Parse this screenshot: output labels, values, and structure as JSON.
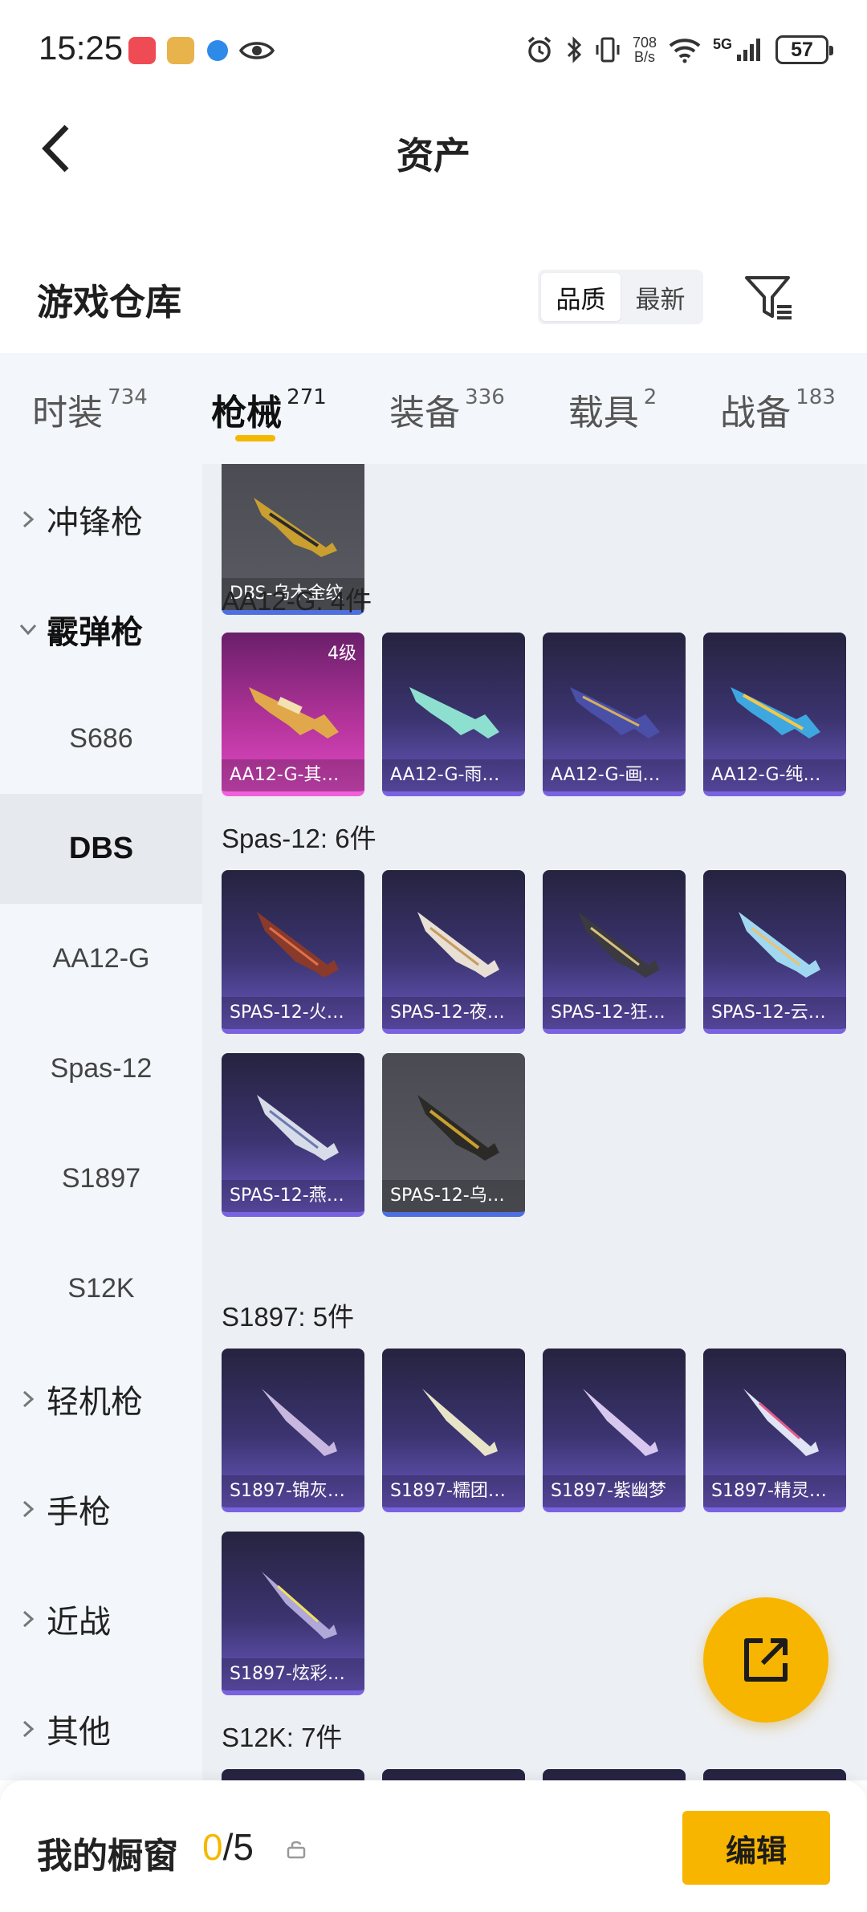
{
  "status_bar": {
    "time": "15:25",
    "net_speed_value": "708",
    "net_speed_unit": "B/s",
    "network": "5G",
    "battery": "57"
  },
  "header": {
    "title": "资产"
  },
  "warehouse": {
    "title": "游戏仓库",
    "sort_options": [
      "品质",
      "最新"
    ],
    "active_sort": "品质"
  },
  "tabs": [
    {
      "label": "时装",
      "count": "734"
    },
    {
      "label": "枪械",
      "count": "271"
    },
    {
      "label": "装备",
      "count": "336"
    },
    {
      "label": "载具",
      "count": "2"
    },
    {
      "label": "战备",
      "count": "183"
    }
  ],
  "sidebar": {
    "items": [
      {
        "label": "冲锋枪"
      },
      {
        "label": "霰弹枪"
      },
      {
        "label": "S686"
      },
      {
        "label": "DBS"
      },
      {
        "label": "AA12-G"
      },
      {
        "label": "Spas-12"
      },
      {
        "label": "S1897"
      },
      {
        "label": "S12K"
      },
      {
        "label": "轻机枪"
      },
      {
        "label": "手枪"
      },
      {
        "label": "近战"
      },
      {
        "label": "其他"
      }
    ]
  },
  "groups": {
    "dbs": {
      "items": [
        {
          "name": "DBS-乌木金纹"
        }
      ]
    },
    "aa12": {
      "title": "AA12-G: 4件",
      "items": [
        {
          "name": "AA12-G-其…",
          "badge": "4级"
        },
        {
          "name": "AA12-G-雨…"
        },
        {
          "name": "AA12-G-画…"
        },
        {
          "name": "AA12-G-纯…"
        }
      ]
    },
    "spas": {
      "title": "Spas-12: 6件",
      "items": [
        {
          "name": "SPAS-12-火…"
        },
        {
          "name": "SPAS-12-夜…"
        },
        {
          "name": "SPAS-12-狂…"
        },
        {
          "name": "SPAS-12-云…"
        },
        {
          "name": "SPAS-12-燕…"
        },
        {
          "name": "SPAS-12-乌…"
        }
      ]
    },
    "s1897": {
      "title": "S1897: 5件",
      "items": [
        {
          "name": "S1897-锦灰…"
        },
        {
          "name": "S1897-糯团…"
        },
        {
          "name": "S1897-紫幽梦"
        },
        {
          "name": "S1897-精灵…"
        },
        {
          "name": "S1897-炫彩…"
        }
      ]
    },
    "s12k": {
      "title": "S12K: 7件"
    }
  },
  "showcase": {
    "title": "我的橱窗",
    "current": "0",
    "separator": "/5",
    "edit_label": "编辑"
  },
  "colors": {
    "accent": "#f7b500",
    "epic_purple": "#7a63e0",
    "legendary_pink": "#e04bc6"
  }
}
